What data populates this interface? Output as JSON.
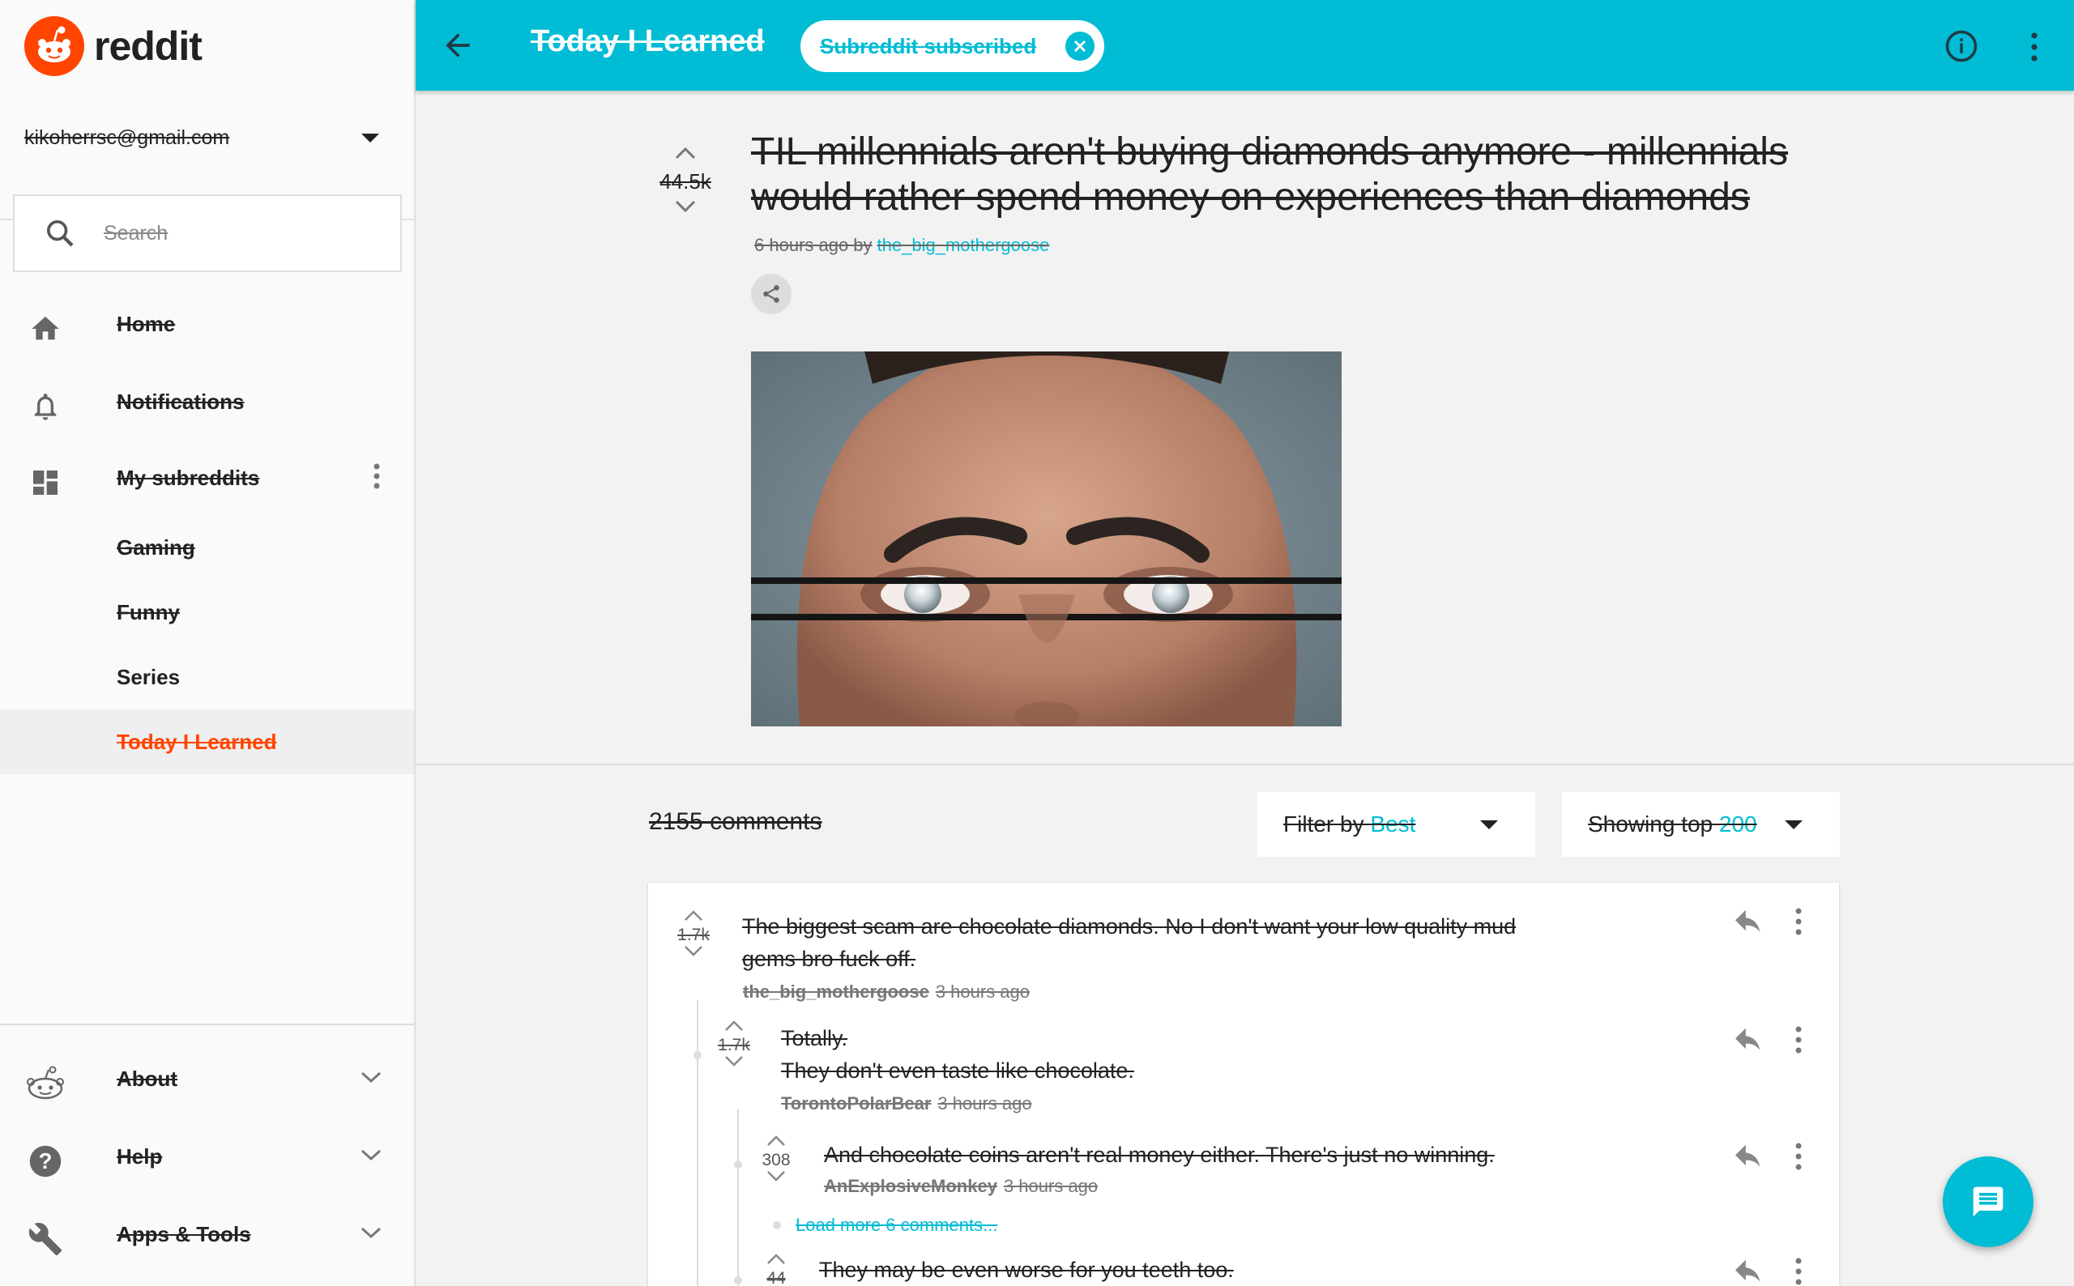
{
  "app": {
    "name": "reddit",
    "brand_color": "#ff4500",
    "accent_color": "#00bcd4"
  },
  "sidebar": {
    "account_email": "kikoherrsc@gmail.com",
    "search_placeholder": "Search",
    "nav": [
      {
        "label": "Home",
        "icon": "home-icon"
      },
      {
        "label": "Notifications",
        "icon": "bell-icon"
      },
      {
        "label": "My subreddits",
        "icon": "dashboard-icon"
      }
    ],
    "subreddits": [
      "Gaming",
      "Funny",
      "Series",
      "Today I Learned"
    ],
    "active_subreddit": "Today I Learned",
    "footer": [
      {
        "label": "About",
        "icon": "snoo-icon"
      },
      {
        "label": "Help",
        "icon": "help-icon"
      },
      {
        "label": "Apps & Tools",
        "icon": "wrench-icon"
      }
    ]
  },
  "topbar": {
    "title": "Today I Learned",
    "subscribed_chip": "Subreddit subscribed"
  },
  "post": {
    "score": "44.5k",
    "title": "TIL millennials aren't buying diamonds anymore - millennials would rather spend money on experiences than diamonds",
    "time": "6 hours ago by",
    "author": "the_big_mothergoose"
  },
  "comments_header": {
    "count": "2155 comments",
    "filter_prefix": "Filter by",
    "filter_value": "Best",
    "showing_prefix": "Showing top",
    "showing_value": "200"
  },
  "comments": [
    {
      "score": "1.7k",
      "text_lines": [
        "The biggest scam are chocolate diamonds. No I don't want your low quality mud",
        "gems bro fuck off."
      ],
      "author": "the_big_mothergoose",
      "time": "3 hours ago"
    },
    {
      "score": "1.7k",
      "text_lines": [
        "Totally.",
        "They don't even taste like chocolate."
      ],
      "author": "TorontoPolarBear",
      "time": "3 hours ago"
    },
    {
      "score": "308",
      "text_lines": [
        "And chocolate coins aren't real money either. There's just no winning."
      ],
      "author": "AnExplosiveMonkey",
      "time": "3 hours ago"
    },
    {
      "load_more": "Load more 6 comments..."
    },
    {
      "score": "44",
      "text_lines": [
        "They may be even worse for you teeth too."
      ]
    }
  ]
}
